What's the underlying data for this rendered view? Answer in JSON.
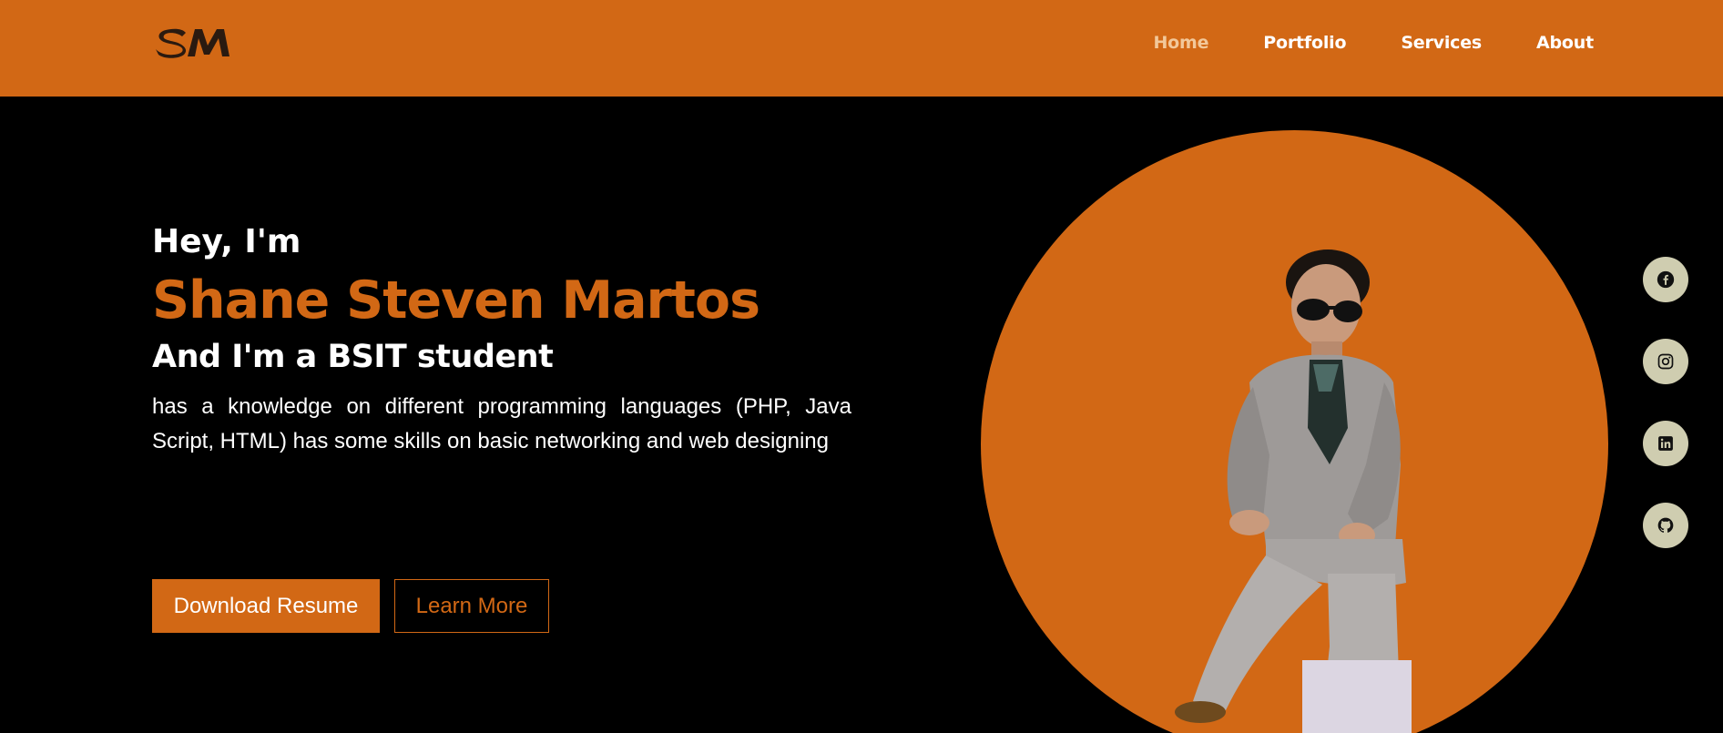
{
  "brand": {
    "logo_text": "SM"
  },
  "nav": {
    "items": [
      {
        "label": "Home",
        "active": true
      },
      {
        "label": "Portfolio",
        "active": false
      },
      {
        "label": "Services",
        "active": false
      },
      {
        "label": "About",
        "active": false
      }
    ]
  },
  "hero": {
    "greeting": "Hey, I'm",
    "name": "Shane Steven Martos",
    "role": "And I'm a BSIT student",
    "description": "has a knowledge on different programming languages (PHP, Java Script, HTML) has some skills on basic networking and web designing",
    "primary_button": "Download Resume",
    "secondary_button": "Learn More"
  },
  "socials": [
    {
      "icon": "facebook-icon"
    },
    {
      "icon": "instagram-icon"
    },
    {
      "icon": "linkedin-icon"
    },
    {
      "icon": "github-icon"
    }
  ],
  "colors": {
    "accent": "#d26815",
    "background": "#000000",
    "text": "#ffffff",
    "nav_active": "#f2c89a",
    "social_bg": "#cfcdb0"
  }
}
